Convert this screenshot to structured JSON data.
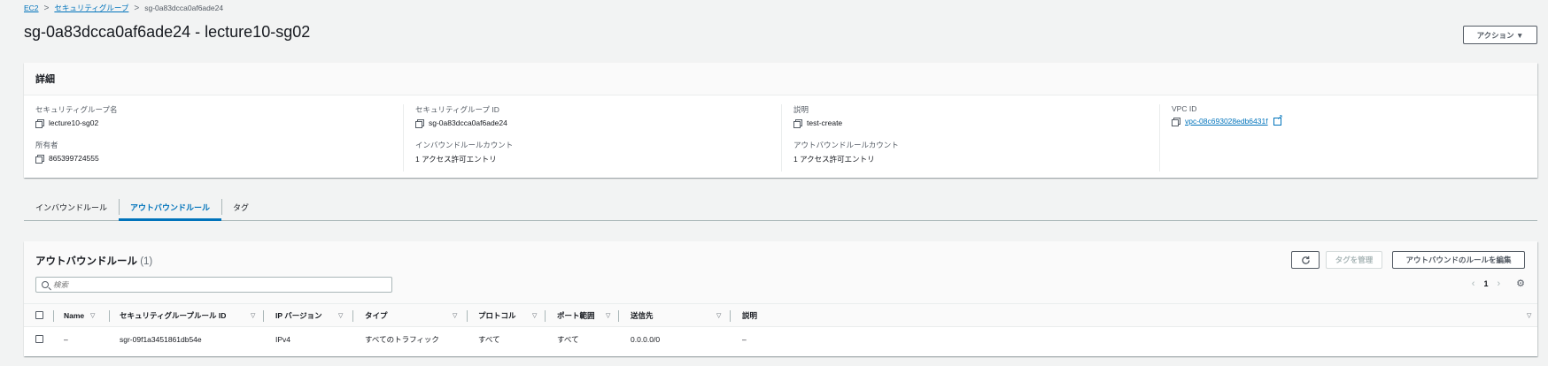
{
  "breadcrumb": {
    "root": "EC2",
    "parent": "セキュリティグループ",
    "current": "sg-0a83dcca0af6ade24",
    "separator": ">"
  },
  "title": "sg-0a83dcca0af6ade24 - lecture10-sg02",
  "actions_button": "アクション ▼",
  "details": {
    "header": "詳細",
    "fields": {
      "sg_name_label": "セキュリティグループ名",
      "sg_name_value": "lecture10-sg02",
      "sg_id_label": "セキュリティグループ ID",
      "sg_id_value": "sg-0a83dcca0af6ade24",
      "description_label": "説明",
      "description_value": "test-create",
      "vpc_id_label": "VPC ID",
      "vpc_id_value": "vpc-08c693028edb6431f",
      "owner_label": "所有者",
      "owner_value": "865399724555",
      "inbound_count_label": "インバウンドルールカウント",
      "inbound_count_value": "1 アクセス許可エントリ",
      "outbound_count_label": "アウトバウンドルールカウント",
      "outbound_count_value": "1 アクセス許可エントリ"
    }
  },
  "tabs": [
    "インバウンドルール",
    "アウトバウンドルール",
    "タグ"
  ],
  "active_tab": "アウトバウンドルール",
  "rules": {
    "title": "アウトバウンドルール",
    "count": "(1)",
    "refresh_icon": "refresh-icon",
    "manage_tags_button": "タグを管理",
    "edit_button": "アウトバウンドのルールを編集",
    "search_placeholder": "検索",
    "page": "1",
    "columns": [
      "Name",
      "セキュリティグループルール ID",
      "IP バージョン",
      "タイプ",
      "プロトコル",
      "ポート範囲",
      "送信先",
      "説明"
    ],
    "rows": [
      {
        "name": "–",
        "rule_id": "sgr-09f1a3451861db54e",
        "ip_version": "IPv4",
        "type": "すべてのトラフィック",
        "protocol": "すべて",
        "port_range": "すべて",
        "destination": "0.0.0.0/0",
        "description": "–"
      }
    ]
  },
  "colors": {
    "link": "#0073bb",
    "background": "#f2f3f3",
    "text": "#16191f"
  }
}
